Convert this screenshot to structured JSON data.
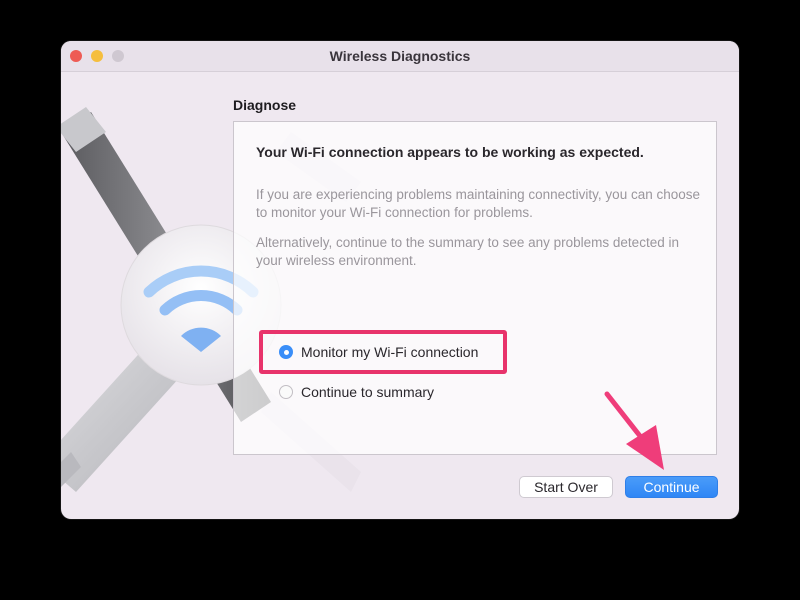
{
  "window": {
    "title": "Wireless Diagnostics"
  },
  "section": {
    "title": "Diagnose"
  },
  "panel": {
    "headline": "Your Wi-Fi connection appears to be working as expected.",
    "paragraph1": "If you are experiencing problems maintaining connectivity, you can choose to monitor your Wi-Fi connection for problems.",
    "paragraph2": "Alternatively, continue to the summary to see any problems detected in your wireless environment."
  },
  "options": [
    {
      "label": "Monitor my Wi-Fi connection",
      "selected": true
    },
    {
      "label": "Continue to summary",
      "selected": false
    }
  ],
  "buttons": {
    "start_over": "Start Over",
    "continue": "Continue"
  },
  "colors": {
    "accent": "#2f86f5",
    "highlight": "#e8336b"
  },
  "icons": {
    "hero": "wifi-diagnostics-icon",
    "annotation": "arrow-pointer-icon"
  }
}
